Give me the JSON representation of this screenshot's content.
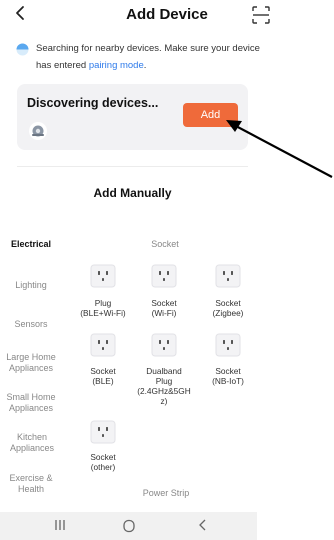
{
  "header": {
    "title": "Add Device",
    "back_icon": "chevron-left-icon",
    "scan_icon": "scan-icon"
  },
  "search": {
    "text": "Searching for nearby devices. Make sure your device has entered",
    "link": "pairing mode",
    "suffix": "."
  },
  "discovering": {
    "title": "Discovering devices...",
    "add_label": "Add"
  },
  "manual": {
    "title": "Add Manually"
  },
  "categories": [
    {
      "label": "Electrical",
      "active": true
    },
    {
      "label": "Lighting",
      "active": false
    },
    {
      "label": "Sensors",
      "active": false
    },
    {
      "label": "Large Home Appliances",
      "active": false
    },
    {
      "label": "Small Home Appliances",
      "active": false
    },
    {
      "label": "Kitchen Appliances",
      "active": false
    },
    {
      "label": "Exercise & Health",
      "active": false
    }
  ],
  "sections": {
    "socket_header": "Socket",
    "power_strip_header": "Power Strip"
  },
  "devices": [
    {
      "label": "Plug\n(BLE+Wi-Fi)",
      "icon": "plug-socket-icon"
    },
    {
      "label": "Socket\n(Wi-Fi)",
      "icon": "plug-socket-icon"
    },
    {
      "label": "Socket\n(Zigbee)",
      "icon": "plug-socket-icon"
    },
    {
      "label": "Socket\n(BLE)",
      "icon": "plug-socket-icon"
    },
    {
      "label": "Dualband\nPlug\n(2.4GHz&5GH\nz)",
      "icon": "plug-socket-icon"
    },
    {
      "label": "Socket\n(NB-IoT)",
      "icon": "plug-socket-icon"
    },
    {
      "label": "Socket\n(other)",
      "icon": "plug-socket-icon"
    }
  ],
  "navbar": {
    "recent_icon": "recent-apps-icon",
    "home_icon": "home-icon",
    "back_icon": "back-icon"
  },
  "colors": {
    "accent": "#ef6a3a",
    "link": "#2f7bea",
    "card_bg": "#f2f2f4"
  }
}
